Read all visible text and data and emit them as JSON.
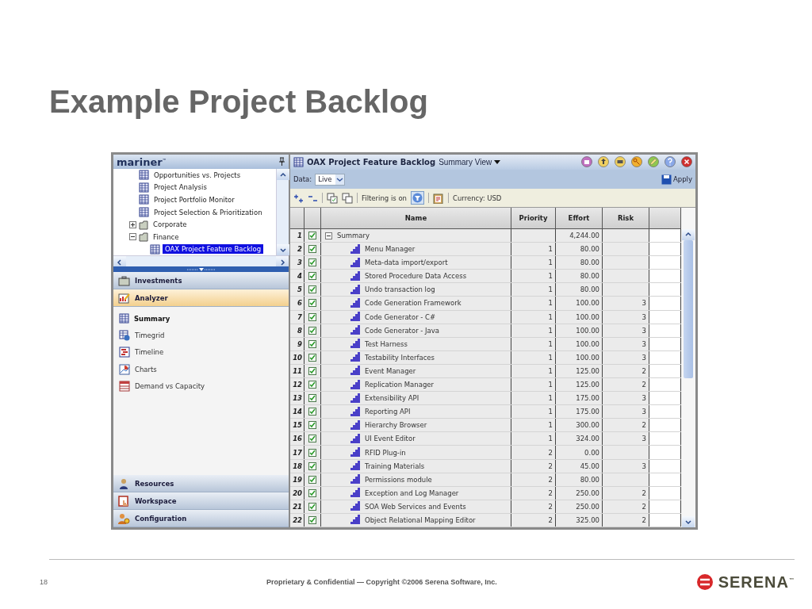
{
  "slide": {
    "title": "Example Project Backlog",
    "page_number": "18",
    "footer": "Proprietary & Confidential — Copyright ©2006 Serena Software, Inc.",
    "brand": "SERENA$^{™}$"
  },
  "sidebar": {
    "logo": "mariner$^{™}$",
    "tree": [
      {
        "label": "Opportunities vs. Projects",
        "kind": "report",
        "selected": false
      },
      {
        "label": "Project Analysis",
        "kind": "report",
        "selected": false
      },
      {
        "label": "Project Portfolio Monitor",
        "kind": "report",
        "selected": false
      },
      {
        "label": "Project Selection & Prioritization",
        "kind": "report",
        "selected": false
      },
      {
        "label": "Corporate",
        "kind": "folder",
        "expanded": false,
        "selected": false
      },
      {
        "label": "Finance",
        "kind": "folder",
        "expanded": true,
        "selected": false,
        "children": [
          {
            "label": "OAX Project Feature Backlog",
            "kind": "report",
            "selected": true
          }
        ]
      }
    ],
    "sections": [
      {
        "label": "Investments",
        "kind": "investments",
        "selected": false
      },
      {
        "label": "Analyzer",
        "kind": "analyzer",
        "selected": true,
        "children": [
          {
            "label": "Summary",
            "kind": "grid",
            "selected": true
          },
          {
            "label": "Timegrid",
            "kind": "timegrid",
            "selected": false
          },
          {
            "label": "Timeline",
            "kind": "timeline",
            "selected": false
          },
          {
            "label": "Charts",
            "kind": "chart",
            "selected": false
          },
          {
            "label": "Demand vs Capacity",
            "kind": "capacity",
            "selected": false
          }
        ]
      },
      {
        "label": "Resources",
        "kind": "resources",
        "selected": false
      },
      {
        "label": "Workspace",
        "kind": "workspace",
        "selected": false
      },
      {
        "label": "Configuration",
        "kind": "configuration",
        "selected": false
      }
    ]
  },
  "main": {
    "title": "OAX Project Feature Backlog",
    "view": "Summary View",
    "data_label": "Data:",
    "data_value": "Live",
    "apply": "Apply",
    "filter_label": "Filtering is on",
    "filter_on": true,
    "currency": "Currency: USD",
    "columns": [
      "Name",
      "Priority",
      "Effort",
      "Risk"
    ],
    "rows": [
      {
        "num": "1",
        "checked": true,
        "name": "Summary",
        "effort": "4,244.00",
        "kind": "summary",
        "expanded": true,
        "children": [
          {
            "num": "2",
            "checked": true,
            "name": "Menu Manager",
            "priority": "1",
            "effort": "80.00",
            "kind": "feature"
          },
          {
            "num": "3",
            "checked": true,
            "name": "Meta-data import/export",
            "priority": "1",
            "effort": "80.00",
            "kind": "feature"
          },
          {
            "num": "4",
            "checked": true,
            "name": "Stored Procedure Data Access",
            "priority": "1",
            "effort": "80.00",
            "kind": "feature"
          },
          {
            "num": "5",
            "checked": true,
            "name": "Undo transaction log",
            "priority": "1",
            "effort": "80.00",
            "kind": "feature"
          },
          {
            "num": "6",
            "checked": true,
            "name": "Code Generation Framework",
            "priority": "1",
            "effort": "100.00",
            "risk": "3",
            "kind": "feature"
          },
          {
            "num": "7",
            "checked": true,
            "name": "Code Generator - C#",
            "priority": "1",
            "effort": "100.00",
            "risk": "3",
            "kind": "feature"
          },
          {
            "num": "8",
            "checked": true,
            "name": "Code Generator - Java",
            "priority": "1",
            "effort": "100.00",
            "risk": "3",
            "kind": "feature"
          },
          {
            "num": "9",
            "checked": true,
            "name": "Test Harness",
            "priority": "1",
            "effort": "100.00",
            "risk": "3",
            "kind": "feature"
          },
          {
            "num": "10",
            "checked": true,
            "name": "Testability Interfaces",
            "priority": "1",
            "effort": "100.00",
            "risk": "3",
            "kind": "feature"
          },
          {
            "num": "11",
            "checked": true,
            "name": "Event Manager",
            "priority": "1",
            "effort": "125.00",
            "risk": "2",
            "kind": "feature"
          },
          {
            "num": "12",
            "checked": true,
            "name": "Replication Manager",
            "priority": "1",
            "effort": "125.00",
            "risk": "2",
            "kind": "feature"
          },
          {
            "num": "13",
            "checked": true,
            "name": "Extensibility API",
            "priority": "1",
            "effort": "175.00",
            "risk": "3",
            "kind": "feature"
          },
          {
            "num": "14",
            "checked": true,
            "name": "Reporting API",
            "priority": "1",
            "effort": "175.00",
            "risk": "3",
            "kind": "feature"
          },
          {
            "num": "15",
            "checked": true,
            "name": "Hierarchy Browser",
            "priority": "1",
            "effort": "300.00",
            "risk": "2",
            "kind": "feature"
          },
          {
            "num": "16",
            "checked": true,
            "name": "UI Event Editor",
            "priority": "1",
            "effort": "324.00",
            "risk": "3",
            "kind": "feature"
          },
          {
            "num": "17",
            "checked": true,
            "name": "RFID Plug-in",
            "priority": "2",
            "effort": "0.00",
            "kind": "feature"
          },
          {
            "num": "18",
            "checked": true,
            "name": "Training Materials",
            "priority": "2",
            "effort": "45.00",
            "risk": "3",
            "kind": "feature"
          },
          {
            "num": "19",
            "checked": true,
            "name": "Permissions module",
            "priority": "2",
            "effort": "80.00",
            "kind": "feature"
          },
          {
            "num": "20",
            "checked": true,
            "name": "Exception and Log Manager",
            "priority": "2",
            "effort": "250.00",
            "risk": "2",
            "kind": "feature"
          },
          {
            "num": "21",
            "checked": true,
            "name": "SOA Web Services and Events",
            "priority": "2",
            "effort": "250.00",
            "risk": "2",
            "kind": "feature"
          },
          {
            "num": "22",
            "checked": true,
            "name": "Object Relational Mapping Editor",
            "priority": "2",
            "effort": "325.00",
            "risk": "2",
            "kind": "feature"
          }
        ]
      }
    ]
  }
}
